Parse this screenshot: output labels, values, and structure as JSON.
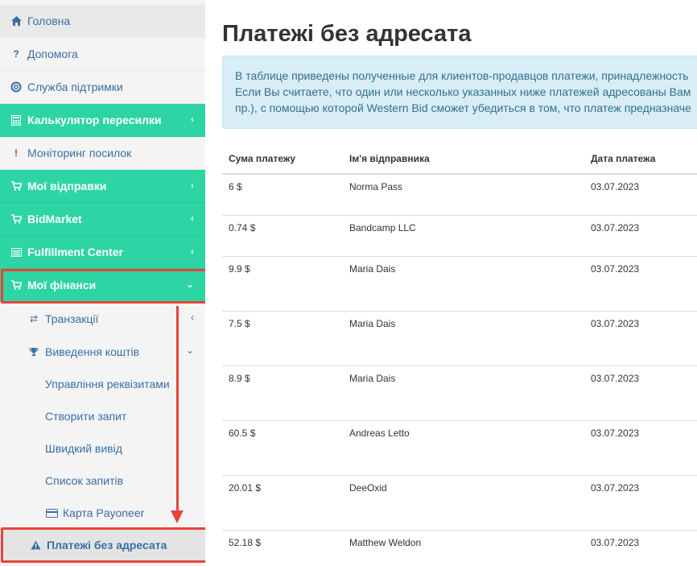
{
  "sidebar": {
    "items": [
      {
        "label": "Головна",
        "icon": "home-icon"
      },
      {
        "label": "Допомога",
        "icon": "question-icon"
      },
      {
        "label": "Служба підтримки",
        "icon": "lifebuoy-icon"
      },
      {
        "label": "Калькулятор пересилки",
        "icon": "calculator-icon"
      },
      {
        "label": "Моніторинг посилок",
        "icon": "exclamation-icon"
      },
      {
        "label": "Мої відправки",
        "icon": "cart-icon"
      },
      {
        "label": "BidMarket",
        "icon": "cart-icon"
      },
      {
        "label": "Fulfillment Center",
        "icon": "list-icon"
      },
      {
        "label": "Мої фінанси",
        "icon": "cart-icon"
      }
    ],
    "finance_sub": [
      {
        "label": "Транзакції",
        "icon": "exchange-icon"
      },
      {
        "label": "Виведення коштів",
        "icon": "trophy-icon"
      }
    ],
    "withdraw_sub": [
      {
        "label": "Управління реквізитами"
      },
      {
        "label": "Створити запит"
      },
      {
        "label": "Швидкий вивід"
      },
      {
        "label": "Список запитів"
      },
      {
        "label": "Карта Payoneer",
        "icon": "credit-card-icon"
      }
    ],
    "active": {
      "label": "Платежі без адресата",
      "icon": "warning-icon"
    }
  },
  "main": {
    "title": "Платежі без адресата",
    "info_lines": [
      "В таблице приведены полученные для клиентов-продавцов платежи, принадлежность",
      "Если Вы считаете, что один или несколько указанных ниже платежей адресованы Вам",
      "пр.), с помощью которой Western Bid сможет убедиться в том, что платеж предназначе"
    ],
    "table": {
      "headers": [
        "Сума платежу",
        "Ім'я відправника",
        "Дата платежа"
      ],
      "rows": [
        [
          "6 $",
          "Norma Pass",
          "03.07.2023"
        ],
        [
          "0.74 $",
          "Bandcamp LLC",
          "03.07.2023"
        ],
        [
          "9.9 $",
          "Maria Dais",
          "03.07.2023"
        ],
        [
          "7.5 $",
          "Maria Dais",
          "03.07.2023"
        ],
        [
          "8.9 $",
          "Maria Dais",
          "03.07.2023"
        ],
        [
          "60.5 $",
          "Andreas Letto",
          "03.07.2023"
        ],
        [
          "20.01 $",
          "DeeOxid",
          "03.07.2023"
        ],
        [
          "52.18 $",
          "Matthew Weldon",
          "03.07.2023"
        ]
      ]
    }
  },
  "colors": {
    "accent_green": "#2dd4a4",
    "link_blue": "#3a6ea5",
    "highlight_red": "#e8443a",
    "info_bg": "#d9edf7"
  }
}
